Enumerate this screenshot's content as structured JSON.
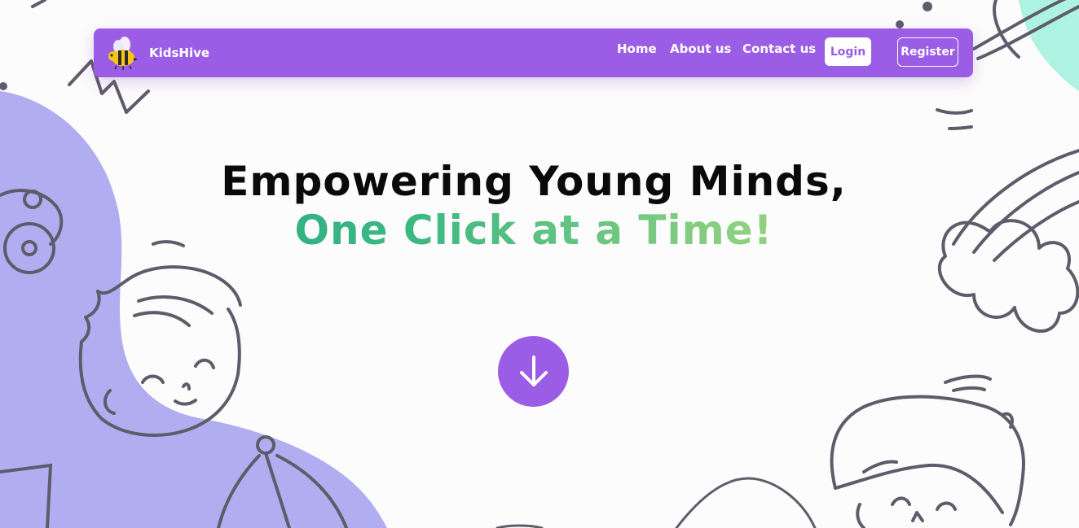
{
  "colors": {
    "accent": "#9b5de5",
    "blob": "#b0adf0",
    "doodle": "#5e5c6a",
    "teal_corner": "#aef2e2",
    "headline_dark": "#0a0a0a",
    "headline_gradient_start": "#16a085",
    "headline_gradient_end": "#a8dd8a"
  },
  "navbar": {
    "brand_name": "KidsHive",
    "brand_icon": "bee-icon",
    "links": [
      "Home",
      "About us",
      "Contact us"
    ],
    "login_label": "Login",
    "register_label": "Register"
  },
  "hero": {
    "line1": "Empowering Young Minds,",
    "line2": "One Click at a Time!",
    "scroll_icon": "arrow-down-icon"
  },
  "decor": {
    "doodles": [
      "planet-icon",
      "rainbow-cloud-icon",
      "boy-face-doodle",
      "boy-cap-doodle",
      "umbrella-doodle"
    ]
  }
}
